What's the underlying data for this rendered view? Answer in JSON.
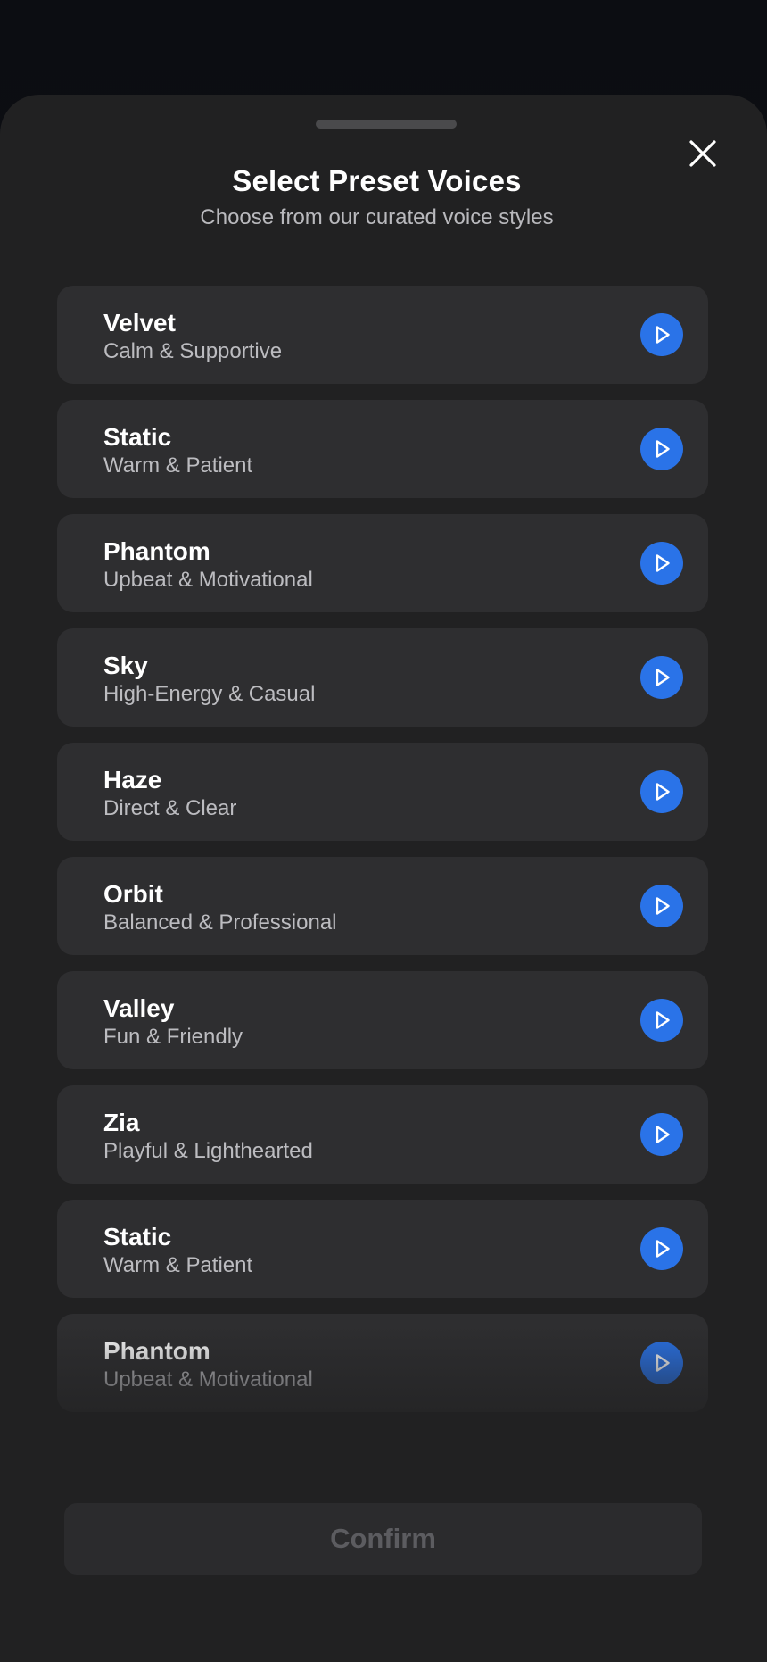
{
  "sheet": {
    "title": "Select Preset Voices",
    "subtitle": "Choose from our curated voice styles",
    "close_icon": "close-icon"
  },
  "voices": [
    {
      "name": "Velvet",
      "description": "Calm & Supportive"
    },
    {
      "name": "Static",
      "description": "Warm & Patient"
    },
    {
      "name": "Phantom",
      "description": "Upbeat & Motivational"
    },
    {
      "name": "Sky",
      "description": "High-Energy & Casual"
    },
    {
      "name": "Haze",
      "description": "Direct & Clear"
    },
    {
      "name": "Orbit",
      "description": "Balanced & Professional"
    },
    {
      "name": "Valley",
      "description": "Fun & Friendly"
    },
    {
      "name": "Zia",
      "description": "Playful & Lighthearted"
    },
    {
      "name": "Static",
      "description": "Warm & Patient"
    },
    {
      "name": "Phantom",
      "description": "Upbeat & Motivational"
    }
  ],
  "play_icon": "play-icon",
  "confirm_label": "Confirm",
  "colors": {
    "accent": "#2a73e8",
    "sheet_background": "#212122",
    "card_background": "#2e2e30",
    "confirm_disabled_text": "#5c5c60"
  }
}
